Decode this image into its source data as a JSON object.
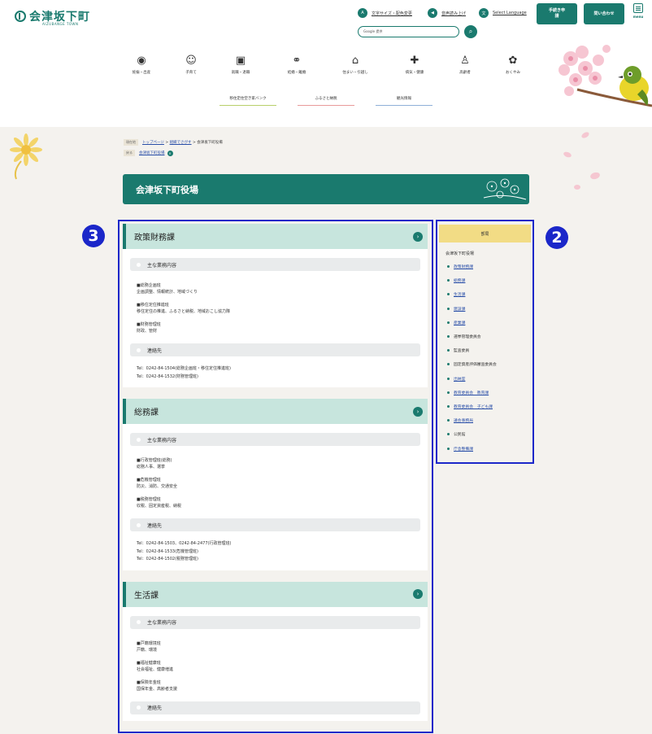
{
  "header": {
    "logo_text": "会津坂下町",
    "logo_sub": "AIZUBANGE TOWN",
    "util": {
      "font_label": "文字サイズ・配色変更",
      "speech_label": "音声読み上げ",
      "lang_label": "Select Language"
    },
    "search": {
      "placeholder": "Google 提供"
    },
    "btn_procedures": "手続き申請",
    "btn_contact": "問い合わせ",
    "menu_label": "menu",
    "gnav": [
      {
        "label": "妊娠・出産",
        "icon": "pregnancy-icon"
      },
      {
        "label": "子育て",
        "icon": "child-icon"
      },
      {
        "label": "就職・退職",
        "icon": "briefcase-icon"
      },
      {
        "label": "結婚・離婚",
        "icon": "rings-icon"
      },
      {
        "label": "住まい・引越し",
        "icon": "house-icon"
      },
      {
        "label": "病気・健康",
        "icon": "medical-icon"
      },
      {
        "label": "高齢者",
        "icon": "elderly-icon"
      },
      {
        "label": "おくやみ",
        "icon": "flower-icon"
      }
    ],
    "sublinks": [
      {
        "label": "移住定住空き家バンク",
        "color": "#b8cf6a"
      },
      {
        "label": "ふるさと納税",
        "color": "#e89a9a"
      },
      {
        "label": "観光情報",
        "color": "#8fb0d8"
      }
    ]
  },
  "breadcrumb": {
    "tag_current": "現在地",
    "home": "トップページ",
    "org": "組織でさがす",
    "current": "会津坂下町役場",
    "tag_back": "戻る",
    "back_link": "会津坂下町役場"
  },
  "page_title": "会津坂下町役場",
  "badges": {
    "main": "3",
    "side": "2"
  },
  "departments": [
    {
      "name": "政策財務課",
      "sec_duties": "主な業務内容",
      "items": [
        {
          "head": "■総務企画班",
          "body": "企画調整、情報統計、地域づくり"
        },
        {
          "head": "■移住定住推進班",
          "body": "移住定住の推進、ふるさと納税、地域おこし協力隊"
        },
        {
          "head": "■財務管理班",
          "body": "財政、管財"
        }
      ],
      "sec_contact": "連絡先",
      "contacts": [
        "Tel：0242-84-1504(総務企画班・移住定住推進班)",
        "Tel：0242-84-1532(財務管理班)"
      ]
    },
    {
      "name": "総務課",
      "sec_duties": "主な業務内容",
      "items": [
        {
          "head": "■行政管理班(総務)",
          "body": "総務人事、選挙"
        },
        {
          "head": "■危機管理班",
          "body": "防災、消防、交通安全"
        },
        {
          "head": "■税務管理班",
          "body": "収税、固定資産税、納税"
        }
      ],
      "sec_contact": "連絡先",
      "contacts": [
        "Tel：0242-84-1503、0242-84-2477(行政管理班)",
        "Tel：0242-84-1533(危機管理班)",
        "Tel：0242-84-1502(税務管理班)"
      ]
    },
    {
      "name": "生活課",
      "sec_duties": "主な業務内容",
      "items": [
        {
          "head": "■戸籍環境班",
          "body": "戸籍、環境"
        },
        {
          "head": "■福祉健康班",
          "body": "社会福祉、健康増進"
        },
        {
          "head": "■保険年金班",
          "body": "国保年金、高齢者支援"
        }
      ],
      "sec_contact": "連絡先",
      "contacts": []
    }
  ],
  "sidebar": {
    "head": "部局",
    "title": "会津坂下町役場",
    "items": [
      {
        "label": "政策財務課",
        "link": true
      },
      {
        "label": "総務課",
        "link": true
      },
      {
        "label": "生活課",
        "link": true
      },
      {
        "label": "建設課",
        "link": true
      },
      {
        "label": "産業課",
        "link": true
      },
      {
        "label": "選挙管理委員会",
        "link": false
      },
      {
        "label": "監査委員",
        "link": false
      },
      {
        "label": "固定資産評価審査委員会",
        "link": false
      },
      {
        "label": "出納室",
        "link": true
      },
      {
        "label": "教育委員会　教育課",
        "link": true
      },
      {
        "label": "教育委員会　子ども課",
        "link": true
      },
      {
        "label": "議会事務局",
        "link": true
      },
      {
        "label": "公民館",
        "link": false
      },
      {
        "label": "庁舎整備課",
        "link": true
      }
    ]
  }
}
